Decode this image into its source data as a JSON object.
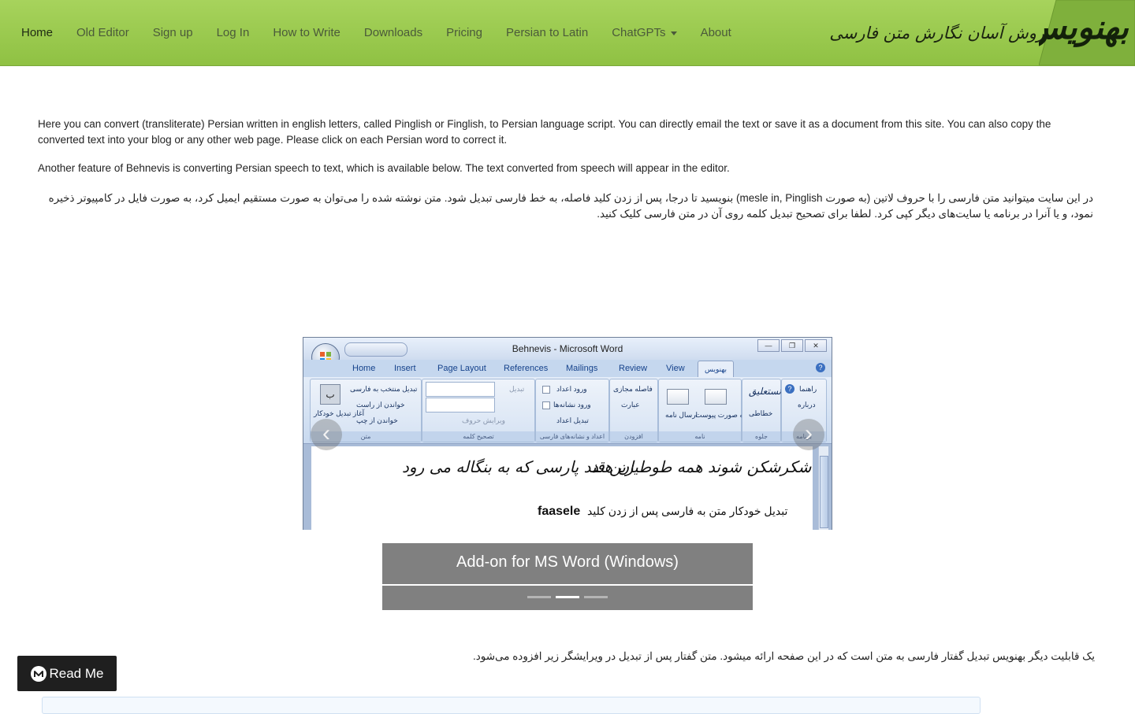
{
  "nav": {
    "items": [
      {
        "label": "Home",
        "active": true
      },
      {
        "label": "Old Editor"
      },
      {
        "label": "Sign up"
      },
      {
        "label": "Log In"
      },
      {
        "label": "How to Write"
      },
      {
        "label": "Downloads"
      },
      {
        "label": "Pricing"
      },
      {
        "label": "Persian to Latin"
      },
      {
        "label": "ChatGPTs",
        "dropdown": true
      },
      {
        "label": "About"
      }
    ]
  },
  "brand": {
    "logo_text": "بهنویس",
    "tagline": "روش آسان نگارش متن فارسی"
  },
  "intro": {
    "p1": "Here you can convert (transliterate) Persian written in english letters, called Pinglish or Finglish, to Persian language script. You can directly email the text or save it as a document from this site. You can also copy the converted text into your blog or any other web page. Please click on each Persian word to correct it.",
    "p2": "Another feature of Behnevis is converting Persian speech to text, which is available below. The text converted from speech will appear in the editor.",
    "p3_fa": "در این سایت میتوانید متن فارسی را با حروف لاتین (به صورت mesle in, Pinglish) بنویسید تا درجا، پس از زدن کلید فاصله، به خط فارسی تبدیل شود. متن نوشته شده را می‌توان به صورت مستقیم ایمیل کرد، به صورت فایل در کامپیوتر ذخیره نمود، و یا آنرا در برنامه یا سایت‌های دیگر کپی کرد. لطفا برای تصحیح تبدیل کلمه روی آن در متن فارسی کلیک کنید."
  },
  "carousel": {
    "slide": {
      "window_title": "Behnevis - Microsoft Word",
      "tabs": [
        "Home",
        "Insert",
        "Page Layout",
        "References",
        "Mailings",
        "Review",
        "View",
        "بهنویس"
      ],
      "groups": [
        {
          "label": "برنامه",
          "items": [
            "راهنما",
            "درباره"
          ]
        },
        {
          "label": "جلوه",
          "items": [
            "نستعلیق",
            "خطاطی"
          ]
        },
        {
          "label": "نامه",
          "items": [
            "ارسال به صورت پیوست",
            "ارسال نامه"
          ]
        },
        {
          "label": "افزودن",
          "items": [
            "فاصله مجازی",
            "عبارت"
          ]
        },
        {
          "label": "اعداد و نشانه‌های فارسی",
          "items": [
            "ورود اعداد",
            "ورود نشانه‌ها",
            "تبدیل اعداد"
          ]
        },
        {
          "label": "تصحیح کلمه",
          "items": [
            "تبدیل",
            "ویرایش حروف"
          ]
        },
        {
          "label": "متن",
          "items": [
            "تبدیل منتخب به فارسی",
            "خواندن از راست",
            "خواندن از چپ",
            "آغاز تبدیل خودکار"
          ]
        }
      ],
      "poem_right": "شکرشکن شوند همه طوطیان هند",
      "poem_left": "زین قند پارسی که به بنگاله می رود",
      "doc_line": "تبدیل خودکار متن به فارسی پس از زدن کلید",
      "latin_word": "faasele"
    },
    "caption": "Add-on for MS Word (Windows)",
    "prev_icon": "‹",
    "next_icon": "›",
    "indicators": [
      false,
      true,
      false
    ]
  },
  "speech_note_fa": "یک قابلیت دیگر بهنویس تبدیل گفتار فارسی به متن است که در این صفحه ارائه میشود. متن گفتار پس از تبدیل در ویرایشگر زیر افزوده می‌شود.",
  "readme": {
    "label": "Read Me",
    "icon": "medium-logo-icon"
  },
  "colors": {
    "navbar": "#98c94b",
    "caption_bg": "#808080",
    "readme_bg": "#1f1f1f"
  }
}
